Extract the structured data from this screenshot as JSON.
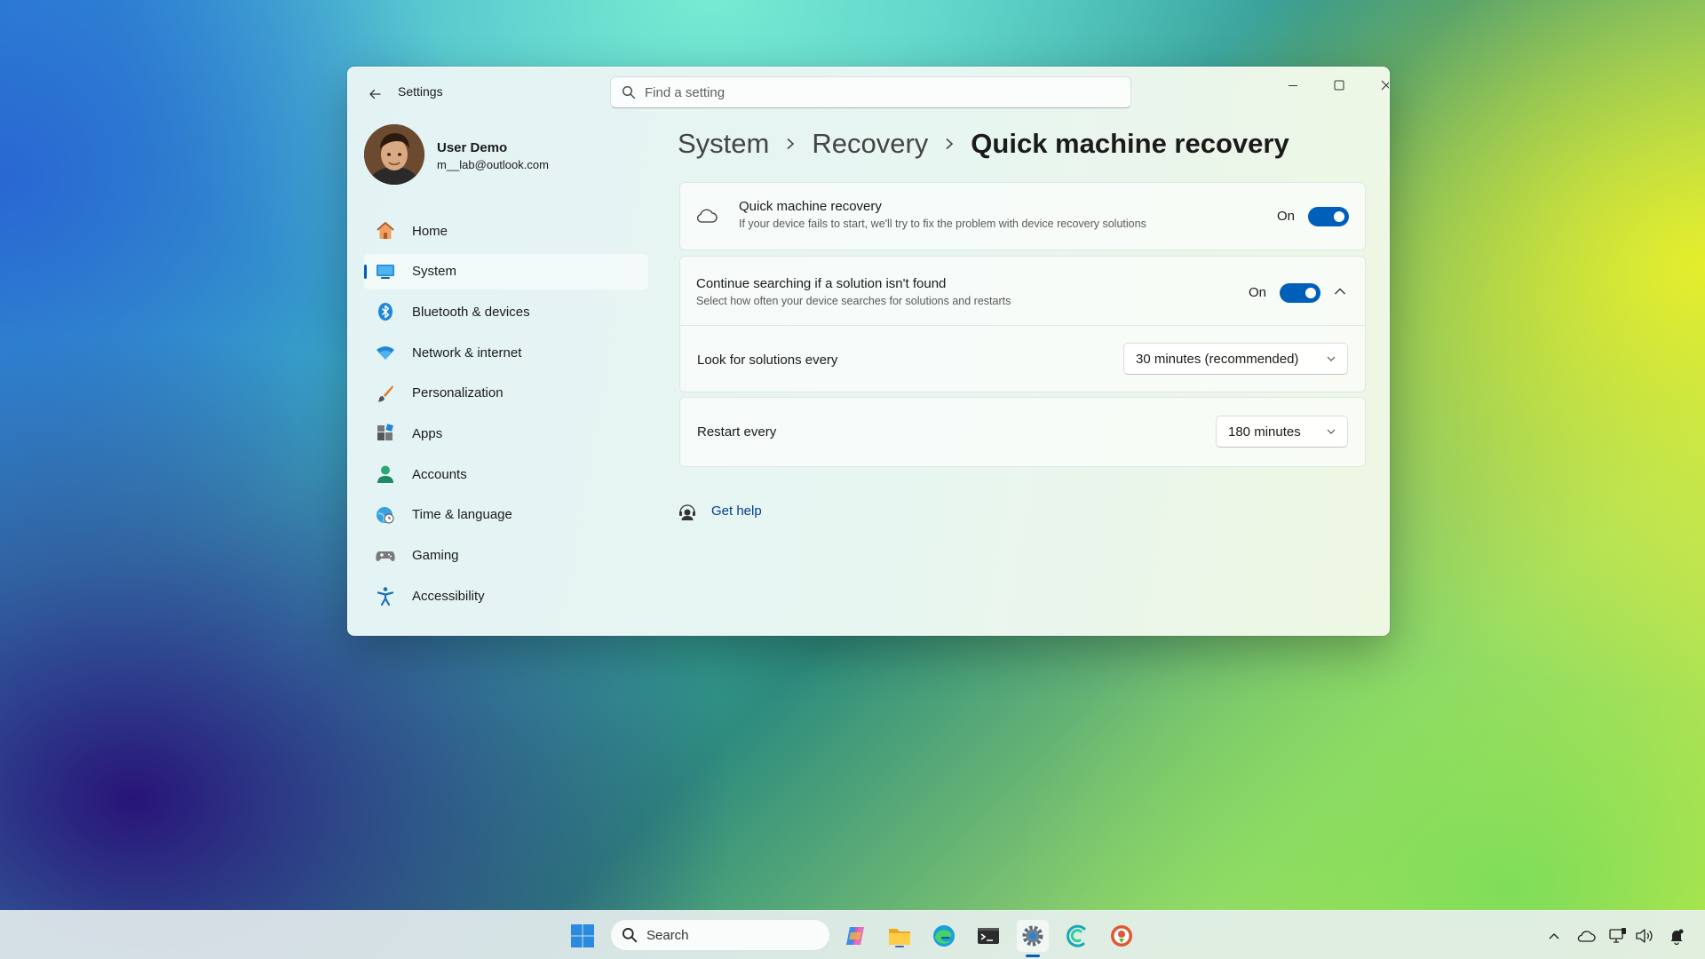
{
  "window": {
    "app_title": "Settings",
    "search_placeholder": "Find a setting"
  },
  "user": {
    "name": "User Demo",
    "email": "m__lab@outlook.com"
  },
  "nav": {
    "items": [
      {
        "label": "Home",
        "icon": "home-icon",
        "active": false
      },
      {
        "label": "System",
        "icon": "system-icon",
        "active": true
      },
      {
        "label": "Bluetooth & devices",
        "icon": "bluetooth-icon",
        "active": false
      },
      {
        "label": "Network & internet",
        "icon": "wifi-icon",
        "active": false
      },
      {
        "label": "Personalization",
        "icon": "brush-icon",
        "active": false
      },
      {
        "label": "Apps",
        "icon": "apps-icon",
        "active": false
      },
      {
        "label": "Accounts",
        "icon": "account-icon",
        "active": false
      },
      {
        "label": "Time & language",
        "icon": "globe-clock-icon",
        "active": false
      },
      {
        "label": "Gaming",
        "icon": "gamepad-icon",
        "active": false
      },
      {
        "label": "Accessibility",
        "icon": "accessibility-icon",
        "active": false
      }
    ]
  },
  "breadcrumb": {
    "level1": "System",
    "level2": "Recovery",
    "current": "Quick machine recovery"
  },
  "settings": {
    "qmr": {
      "title": "Quick machine recovery",
      "description": "If your device fails to start, we'll try to fix the problem with device recovery solutions",
      "state_label": "On",
      "enabled": true
    },
    "continue": {
      "title": "Continue searching if a solution isn't found",
      "description": "Select how often your device searches for solutions and restarts",
      "state_label": "On",
      "enabled": true,
      "expanded": true
    },
    "look_for": {
      "label": "Look for solutions every",
      "value": "30 minutes (recommended)"
    },
    "restart": {
      "label": "Restart every",
      "value": "180 minutes"
    }
  },
  "help": {
    "label": "Get help"
  },
  "taskbar": {
    "search_label": "Search",
    "accent": "#005fb8"
  }
}
